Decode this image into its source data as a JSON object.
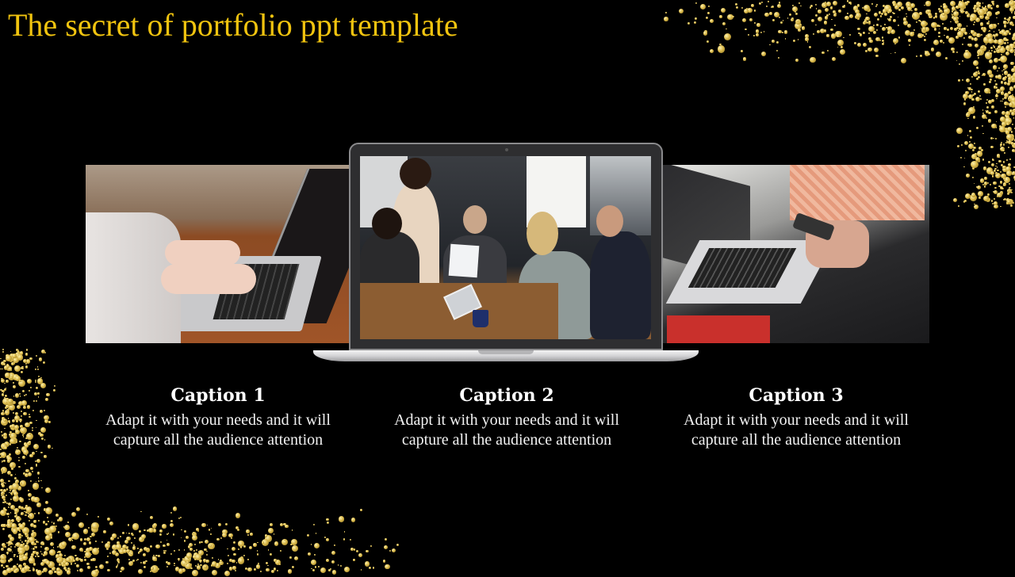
{
  "slide": {
    "title": "The secret of portfolio ppt template",
    "accent_color": "#f1c40f",
    "background_color": "#000000",
    "decoration": "gold-glitter"
  },
  "gallery": {
    "images": [
      {
        "name": "laptop-typing-photo",
        "description": "Hands typing on a laptop on a wooden desk"
      },
      {
        "name": "team-meeting-photo",
        "description": "Business team meeting around a table, shown on a laptop screen"
      },
      {
        "name": "photo-editing-photo",
        "description": "Laptop with photo editing software and a hand holding a phone"
      }
    ]
  },
  "captions": [
    {
      "heading": "Caption 1",
      "body": "Adapt it with your needs and it will capture all the audience attention"
    },
    {
      "heading": "Caption 2",
      "body": "Adapt it with your needs and it will capture all the audience attention"
    },
    {
      "heading": "Caption 3",
      "body": "Adapt it with your needs and it will capture all the audience attention"
    }
  ]
}
